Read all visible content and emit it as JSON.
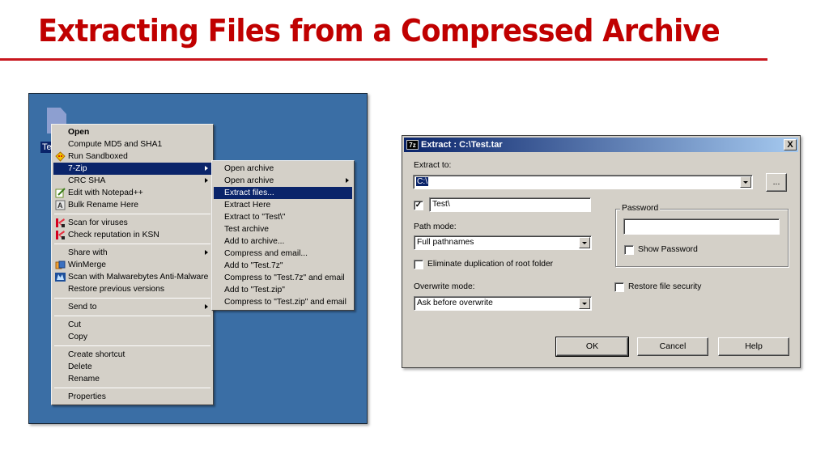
{
  "slide": {
    "title": "Extracting Files from a Compressed Archive",
    "accent_color": "#c00000"
  },
  "desktop": {
    "file_label": "Te",
    "context_menu": {
      "items": [
        {
          "label": "Open",
          "bold": true
        },
        {
          "label": "Compute MD5 and SHA1"
        },
        {
          "label": "Run Sandboxed",
          "icon": "sandboxie-icon"
        },
        {
          "label": "7-Zip",
          "submenu": true,
          "highlighted": true
        },
        {
          "label": "CRC SHA",
          "submenu": true
        },
        {
          "label": "Edit with Notepad++",
          "icon": "notepad-plus-plus-icon"
        },
        {
          "label": "Bulk Rename Here",
          "icon": "bulk-rename-icon"
        },
        {
          "separator": true
        },
        {
          "label": "Scan for viruses",
          "icon": "kaspersky-icon"
        },
        {
          "label": "Check reputation in KSN",
          "icon": "kaspersky-icon"
        },
        {
          "separator": true
        },
        {
          "label": "Share with",
          "submenu": true
        },
        {
          "label": "WinMerge",
          "icon": "winmerge-icon"
        },
        {
          "label": "Scan with Malwarebytes Anti-Malware",
          "icon": "malwarebytes-icon"
        },
        {
          "label": "Restore previous versions"
        },
        {
          "separator": true
        },
        {
          "label": "Send to",
          "submenu": true
        },
        {
          "separator": true
        },
        {
          "label": "Cut"
        },
        {
          "label": "Copy"
        },
        {
          "separator": true
        },
        {
          "label": "Create shortcut"
        },
        {
          "label": "Delete"
        },
        {
          "label": "Rename"
        },
        {
          "separator": true
        },
        {
          "label": "Properties"
        }
      ]
    },
    "submenu_7zip": {
      "items": [
        {
          "label": "Open archive"
        },
        {
          "label": "Open archive",
          "submenu": true
        },
        {
          "label": "Extract files...",
          "highlighted": true
        },
        {
          "label": "Extract Here"
        },
        {
          "label": "Extract to \"Test\\\""
        },
        {
          "label": "Test archive"
        },
        {
          "label": "Add to archive..."
        },
        {
          "label": "Compress and email..."
        },
        {
          "label": "Add to \"Test.7z\""
        },
        {
          "label": "Compress to \"Test.7z\" and email"
        },
        {
          "label": "Add to \"Test.zip\""
        },
        {
          "label": "Compress to \"Test.zip\" and email"
        }
      ]
    }
  },
  "dialog": {
    "app_icon": "7z",
    "title": "Extract : C:\\Test.tar",
    "close_label": "X",
    "extract_to_label": "Extract to:",
    "extract_to_value": "C:\\",
    "browse_label": "...",
    "subfolder_checked": true,
    "subfolder_check_mark": "✓",
    "subfolder_value": "Test\\",
    "path_mode_label": "Path mode:",
    "path_mode_value": "Full pathnames",
    "eliminate_dup_label": "Eliminate duplication of root folder",
    "overwrite_mode_label": "Overwrite mode:",
    "overwrite_mode_value": "Ask before overwrite",
    "password_group_label": "Password",
    "password_value": "",
    "show_password_label": "Show Password",
    "restore_security_label": "Restore file security",
    "buttons": {
      "ok": "OK",
      "cancel": "Cancel",
      "help": "Help"
    }
  }
}
